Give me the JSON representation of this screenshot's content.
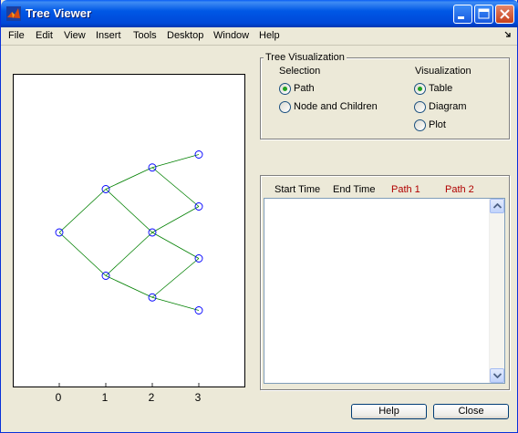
{
  "window": {
    "title": "Tree Viewer"
  },
  "menu": [
    "File",
    "Edit",
    "View",
    "Insert",
    "Tools",
    "Desktop",
    "Window",
    "Help"
  ],
  "plot": {
    "x_ticks": [
      "0",
      "1",
      "2",
      "3"
    ],
    "node_color": "#0000ff",
    "edge_color": "#008000",
    "nodes": [
      {
        "t": 0,
        "v": 0
      },
      {
        "t": 1,
        "v": 1
      },
      {
        "t": 1,
        "v": -1
      },
      {
        "t": 2,
        "v": 1.5
      },
      {
        "t": 2,
        "v": 0
      },
      {
        "t": 2,
        "v": -1.5
      },
      {
        "t": 3,
        "v": 1.8
      },
      {
        "t": 3,
        "v": 0.6
      },
      {
        "t": 3,
        "v": -0.6
      },
      {
        "t": 3,
        "v": -1.8
      }
    ],
    "edges": [
      [
        0,
        1
      ],
      [
        0,
        2
      ],
      [
        1,
        3
      ],
      [
        1,
        4
      ],
      [
        2,
        4
      ],
      [
        2,
        5
      ],
      [
        3,
        6
      ],
      [
        3,
        7
      ],
      [
        4,
        7
      ],
      [
        4,
        8
      ],
      [
        5,
        8
      ],
      [
        5,
        9
      ]
    ]
  },
  "tree_visualization": {
    "title": "Tree Visualization",
    "selection": {
      "heading": "Selection",
      "options": [
        {
          "label": "Path",
          "selected": true
        },
        {
          "label": "Node and Children",
          "selected": false
        }
      ]
    },
    "visualization": {
      "heading": "Visualization",
      "options": [
        {
          "label": "Table",
          "selected": true
        },
        {
          "label": "Diagram",
          "selected": false
        },
        {
          "label": "Plot",
          "selected": false
        }
      ]
    }
  },
  "table": {
    "headers": [
      "Start Time",
      "End Time",
      "Path 1",
      "Path 2"
    ],
    "path_header_color": "#b00000",
    "rows": []
  },
  "buttons": {
    "help": "Help",
    "close": "Close"
  }
}
